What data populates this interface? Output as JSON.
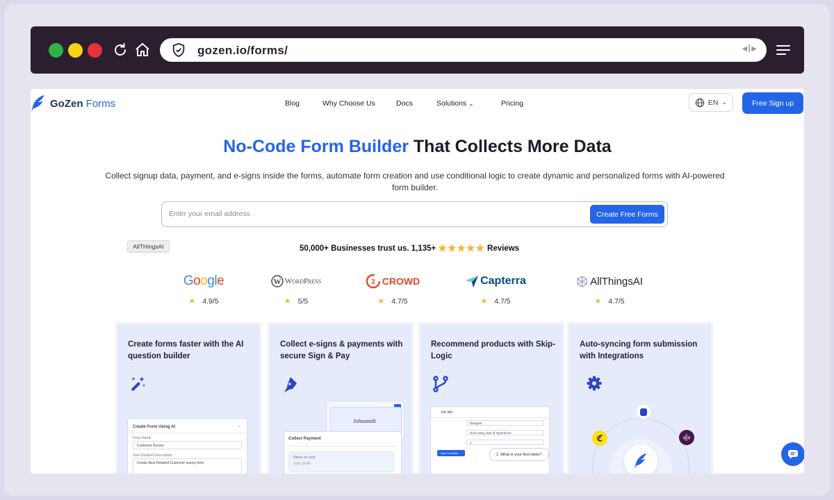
{
  "browser": {
    "url": "gozen.io/forms/"
  },
  "site": {
    "logo_brand": "GoZen",
    "logo_product": "Forms",
    "nav": [
      "Blog",
      "Why Choose Us",
      "Docs",
      "Solutions",
      "Pricing"
    ],
    "language": "EN",
    "signup_label": "Free Sign up"
  },
  "hero": {
    "title_highlight": "No-Code Form Builder",
    "title_rest": " That Collects More Data",
    "subtitle": "Collect signup data, payment, and e-signs inside the forms, automate form creation and use conditional logic to create dynamic and personalized forms with AI-powered form builder.",
    "email_placeholder": "Enter your email address",
    "cta_label": "Create Free Forms",
    "tag": "AllTHingsAI",
    "trust_prefix": "50,000+ Businesses trust us. 1,135+",
    "trust_suffix": "Reviews",
    "trust_stars": 5
  },
  "reviews": [
    {
      "name": "Google",
      "rating": "4.9/5"
    },
    {
      "name": "WordPress",
      "rating": "5/5"
    },
    {
      "name": "CROWD",
      "rating": "4.7/5"
    },
    {
      "name": "Capterra",
      "rating": "4.7/5"
    },
    {
      "name": "AllThingsAI",
      "rating": "4.7/5"
    }
  ],
  "features": [
    {
      "title": "Create forms faster with the AI question builder",
      "icon": "magic-wand-icon"
    },
    {
      "title": "Collect e-signs & payments with secure Sign & Pay",
      "icon": "pen-icon"
    },
    {
      "title": "Recommend products with Skip-Logic",
      "icon": "branch-icon"
    },
    {
      "title": "Auto-syncing form submission with Integrations",
      "icon": "gear-icon"
    }
  ],
  "mockups": {
    "ai_form_title": "Create Form Using AI",
    "ai_form_name_label": "Form Name",
    "ai_form_name_value": "Customer Survey",
    "ai_form_desc_label": "Give Detailed Description",
    "ai_form_desc_value": "Create Best Detailed Customer survey form",
    "signature": "Johnsmith",
    "collect_payment": "Collect Payment",
    "name_on_card": "Name on card",
    "card_holder": "John Smith",
    "logic_header": "Job title",
    "logic_rows": [
      "Designer",
      "How many year of experience",
      "1"
    ],
    "logic_question": "1. What is your first name?",
    "add_condition": "Add Condition"
  },
  "colors": {
    "brand_blue": "#2465e8",
    "browser_bar": "#2b1e2f",
    "card_bg": "#e5ebfb",
    "star": "#f5b52a"
  }
}
